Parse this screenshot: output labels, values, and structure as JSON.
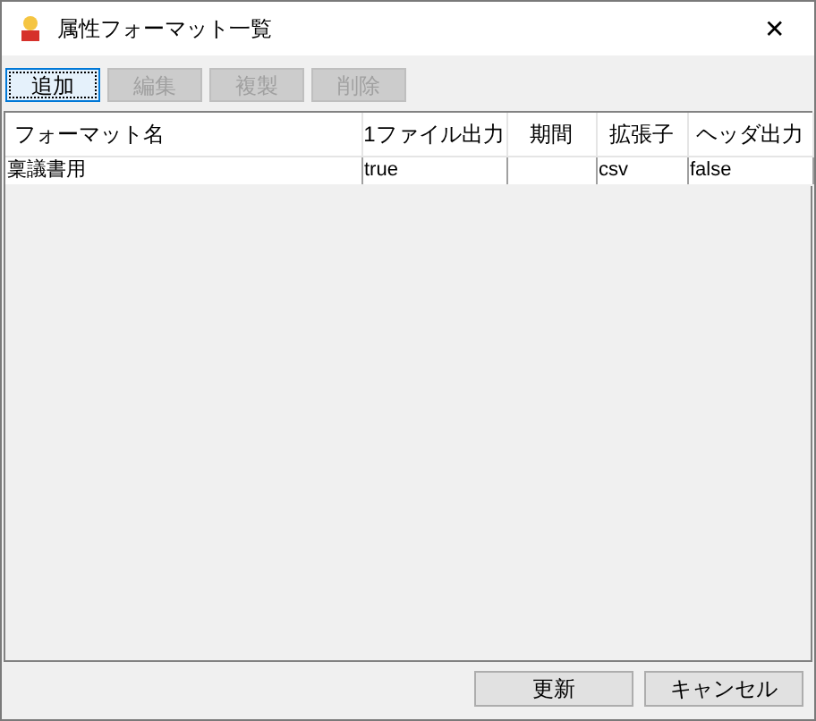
{
  "window": {
    "title": "属性フォーマット一覧",
    "close": "✕"
  },
  "toolbar": [
    {
      "label": "追加",
      "disabled": false
    },
    {
      "label": "編集",
      "disabled": true
    },
    {
      "label": "複製",
      "disabled": true
    },
    {
      "label": "削除",
      "disabled": true
    }
  ],
  "table": {
    "columns": [
      "フォーマット名",
      "1ファイル出力",
      "期間",
      "拡張子",
      "ヘッダ出力"
    ],
    "rows": [
      [
        "稟議書用",
        "true",
        "",
        "csv",
        "false"
      ]
    ]
  },
  "buttons": [
    "更新",
    "キャンセル"
  ]
}
